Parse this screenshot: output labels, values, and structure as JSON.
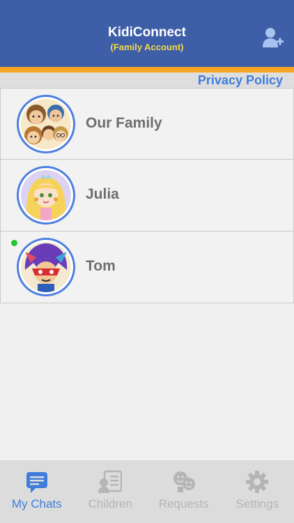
{
  "header": {
    "title": "KidiConnect",
    "subtitle": "(Family Account)",
    "add_icon": "add-user-icon"
  },
  "privacy": {
    "label": "Privacy Policy"
  },
  "chats": [
    {
      "name": "Our Family",
      "avatar": "family-group-avatar",
      "online": false
    },
    {
      "name": "Julia",
      "avatar": "princess-avatar",
      "online": false
    },
    {
      "name": "Tom",
      "avatar": "superhero-avatar",
      "online": true
    }
  ],
  "tabs": [
    {
      "label": "My Chats",
      "icon": "chat-bubble-icon",
      "active": true
    },
    {
      "label": "Children",
      "icon": "children-list-icon",
      "active": false
    },
    {
      "label": "Requests",
      "icon": "requests-faces-icon",
      "active": false
    },
    {
      "label": "Settings",
      "icon": "gear-icon",
      "active": false
    }
  ],
  "colors": {
    "header": "#3e5fa8",
    "stripe": "#f5a623",
    "accent": "#3f7ddb",
    "online": "#22c42f"
  }
}
